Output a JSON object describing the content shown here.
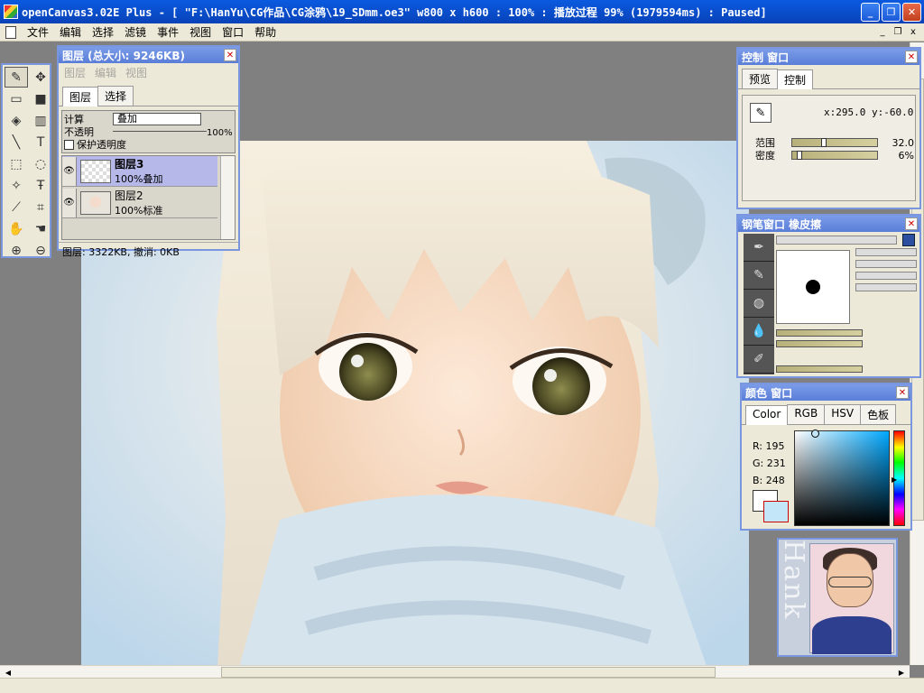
{
  "window": {
    "title": "openCanvas3.02E Plus - [ \"F:\\HanYu\\CG作品\\CG涂鸦\\19_SDmm.oe3\" w800 x h600 : 100% : 播放过程 99% (1979594ms) : Paused]",
    "minimize": "_",
    "restore": "❐",
    "close": "✕"
  },
  "menu": {
    "items": [
      "文件",
      "编辑",
      "选择",
      "滤镜",
      "事件",
      "视图",
      "窗口",
      "帮助"
    ],
    "mdi_min": "_",
    "mdi_restore": "❐",
    "mdi_close": "x"
  },
  "layers_panel": {
    "title": "图层 (总大小: 9246KB)",
    "submenu": [
      "图层",
      "编辑",
      "视图"
    ],
    "tabs": [
      "图层",
      "选择"
    ],
    "mode_label": "计算",
    "mode_value": "叠加",
    "opacity_label": "不透明",
    "opacity_value": "100%",
    "protect_label": "保护透明度",
    "layers": [
      {
        "name": "图层3",
        "mode": "100%叠加",
        "selected": true
      },
      {
        "name": "图层2",
        "mode": "100%标准",
        "selected": false
      }
    ],
    "status": "图层: 3322KB, 撤消: 0KB"
  },
  "control_panel": {
    "title": "控制 窗口",
    "tabs": [
      "预览",
      "控制"
    ],
    "coords": "x:295.0  y:-60.0",
    "range_label": "范围",
    "range_value": "32.0",
    "range_fraction": 0.36,
    "density_label": "密度",
    "density_value": "6%",
    "density_fraction": 0.06
  },
  "brush_panel": {
    "title": "钢笔窗口  橡皮擦"
  },
  "color_panel": {
    "title": "颜色 窗口",
    "tabs": [
      "Color",
      "RGB",
      "HSV",
      "色板"
    ],
    "r": "R: 195",
    "g": "G: 231",
    "b": "B: 248",
    "current_color": "#c3e7f8"
  },
  "avatar": {
    "name": "Hank"
  }
}
